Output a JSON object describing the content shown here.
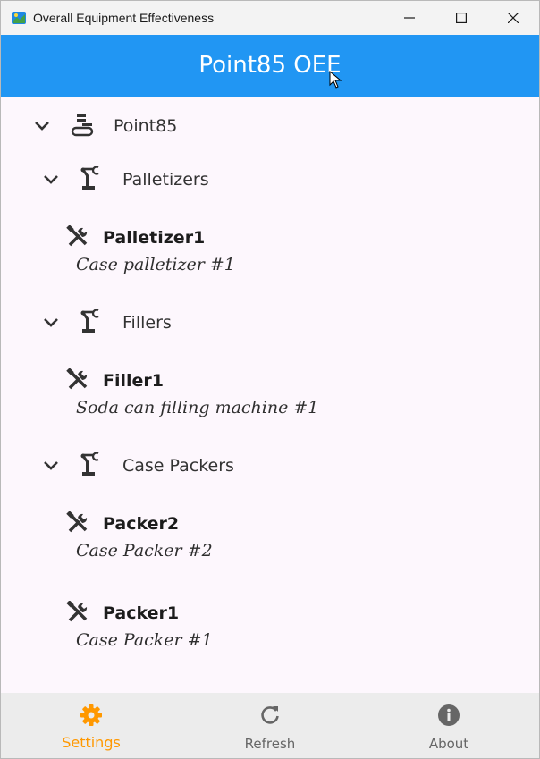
{
  "window": {
    "title": "Overall Equipment Effectiveness"
  },
  "appbar": {
    "title": "Point85 OEE"
  },
  "tree": {
    "root": {
      "label": "Point85"
    },
    "groups": [
      {
        "label": "Palletizers",
        "items": [
          {
            "name": "Palletizer1",
            "description": "Case palletizer #1"
          }
        ]
      },
      {
        "label": "Fillers",
        "items": [
          {
            "name": "Filler1",
            "description": "Soda can filling machine #1"
          }
        ]
      },
      {
        "label": "Case Packers",
        "items": [
          {
            "name": "Packer2",
            "description": "Case Packer #2"
          },
          {
            "name": "Packer1",
            "description": "Case Packer #1"
          }
        ]
      }
    ]
  },
  "bottom_nav": {
    "settings": {
      "label": "Settings",
      "icon": "gear-icon",
      "active": true
    },
    "refresh": {
      "label": "Refresh",
      "icon": "refresh-icon"
    },
    "about": {
      "label": "About",
      "icon": "info-icon"
    }
  },
  "colors": {
    "appbar": "#2196f3",
    "active_tab": "#ff9800",
    "background": "#fdf7fd"
  }
}
